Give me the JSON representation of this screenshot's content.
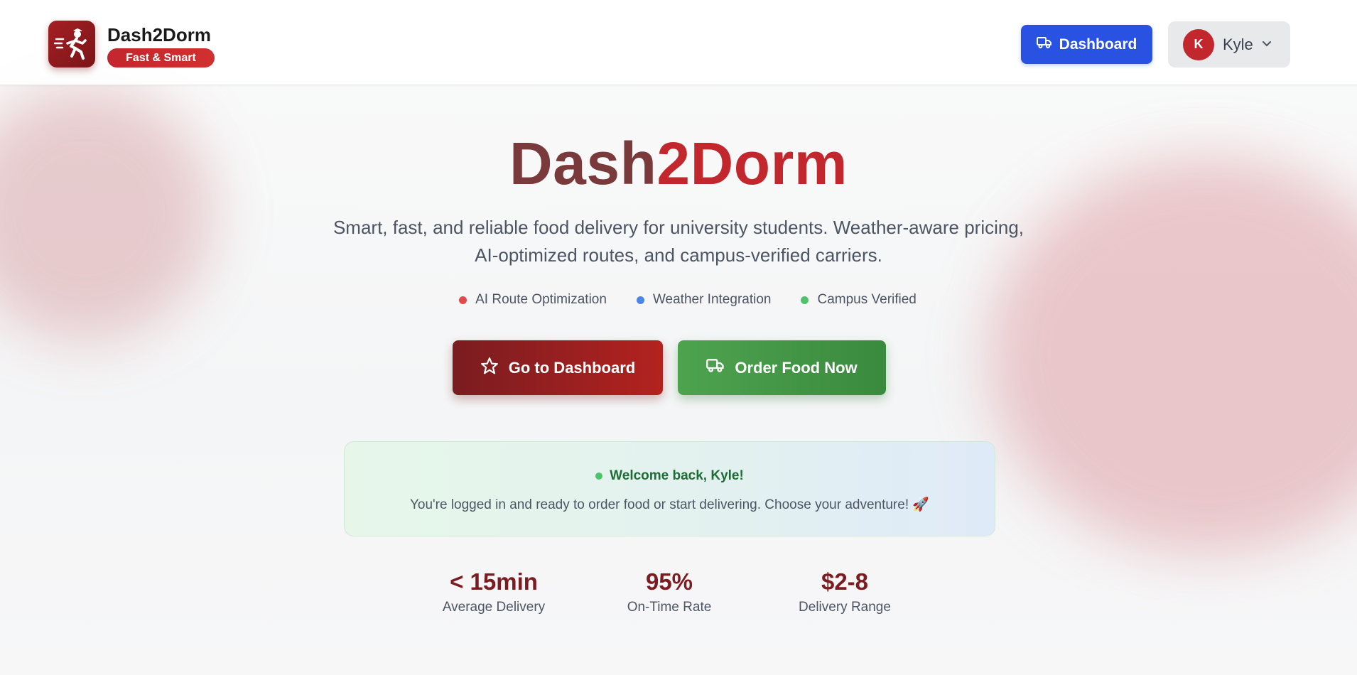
{
  "header": {
    "brand_name": "Dash2Dorm",
    "brand_tagline": "Fast & Smart",
    "dashboard_button": "Dashboard",
    "user": {
      "initial": "K",
      "name": "Kyle"
    }
  },
  "hero": {
    "title_part1": "Dash",
    "title_part2": "2Dorm",
    "subtitle_line1": "Smart, fast, and reliable food delivery for university students. Weather-aware pricing,",
    "subtitle_line2": "AI-optimized routes, and campus-verified carriers.",
    "features": [
      {
        "label": "AI Route Optimization",
        "color": "#e04b4b"
      },
      {
        "label": "Weather Integration",
        "color": "#4a86e8"
      },
      {
        "label": "Campus Verified",
        "color": "#4cc46a"
      }
    ],
    "primary_cta": "Go to Dashboard",
    "secondary_cta": "Order Food Now"
  },
  "welcome": {
    "title": "Welcome back, Kyle!",
    "message": "You're logged in and ready to order food or start delivering. Choose your adventure! 🚀"
  },
  "stats": [
    {
      "value": "< 15min",
      "label": "Average Delivery"
    },
    {
      "value": "95%",
      "label": "On-Time Rate"
    },
    {
      "value": "$2-8",
      "label": "Delivery Range"
    }
  ],
  "colors": {
    "brand_red": "#c1272d",
    "dark_red": "#7a1c20",
    "primary_blue": "#2952e3",
    "green": "#3a8a3e"
  }
}
